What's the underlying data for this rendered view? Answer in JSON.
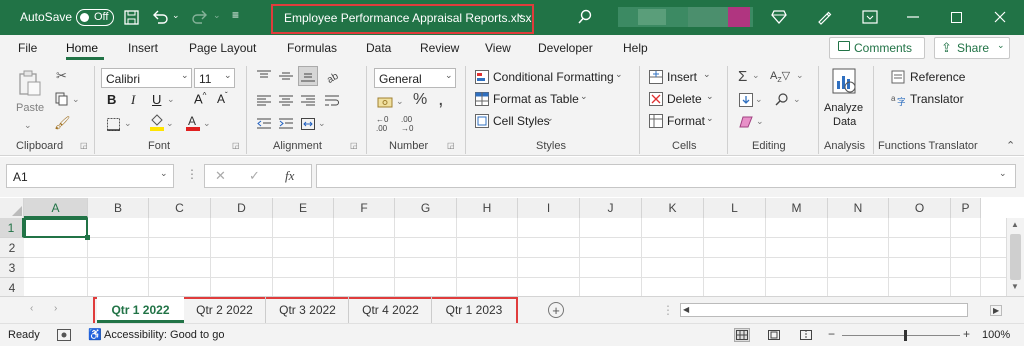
{
  "titlebar": {
    "autosave_label": "AutoSave",
    "autosave_state": "Off",
    "file_title": "Employee Performance Appraisal Reports.xlsx",
    "accent_color": "#217346",
    "highlight_color": "#e03c3c"
  },
  "ribbon_tabs": [
    "File",
    "Home",
    "Insert",
    "Page Layout",
    "Formulas",
    "Data",
    "Review",
    "View",
    "Developer",
    "Help"
  ],
  "comments_label": "Comments",
  "share_label": "Share",
  "clipboard": {
    "paste_label": "Paste",
    "group": "Clipboard"
  },
  "font": {
    "name": "Calibri",
    "size": "11",
    "group": "Font"
  },
  "alignment": {
    "group": "Alignment"
  },
  "number": {
    "format": "General",
    "group": "Number"
  },
  "styles": {
    "conditional": "Conditional Formatting",
    "format_table": "Format as Table",
    "cell_styles": "Cell Styles",
    "group": "Styles"
  },
  "cells": {
    "insert": "Insert",
    "delete": "Delete",
    "format": "Format",
    "group": "Cells"
  },
  "editing": {
    "group": "Editing"
  },
  "analysis": {
    "analyze_line1": "Analyze",
    "analyze_line2": "Data",
    "group": "Analysis"
  },
  "translator": {
    "reference": "Reference",
    "translator": "Translator",
    "group": "Functions Translator"
  },
  "formula_bar": {
    "name_box": "A1",
    "fx": "fx",
    "formula": ""
  },
  "columns": [
    "A",
    "B",
    "C",
    "D",
    "E",
    "F",
    "G",
    "H",
    "I",
    "J",
    "K",
    "L",
    "M",
    "N",
    "O",
    "P"
  ],
  "rows": [
    "1",
    "2",
    "3",
    "4"
  ],
  "sheets": [
    "Qtr 1 2022",
    "Qtr 2 2022",
    "Qtr 3 2022",
    "Qtr 4 2022",
    "Qtr 1 2023"
  ],
  "active_sheet": "Qtr 1 2022",
  "status": {
    "ready": "Ready",
    "accessibility": "Accessibility: Good to go",
    "zoom": "100%"
  }
}
